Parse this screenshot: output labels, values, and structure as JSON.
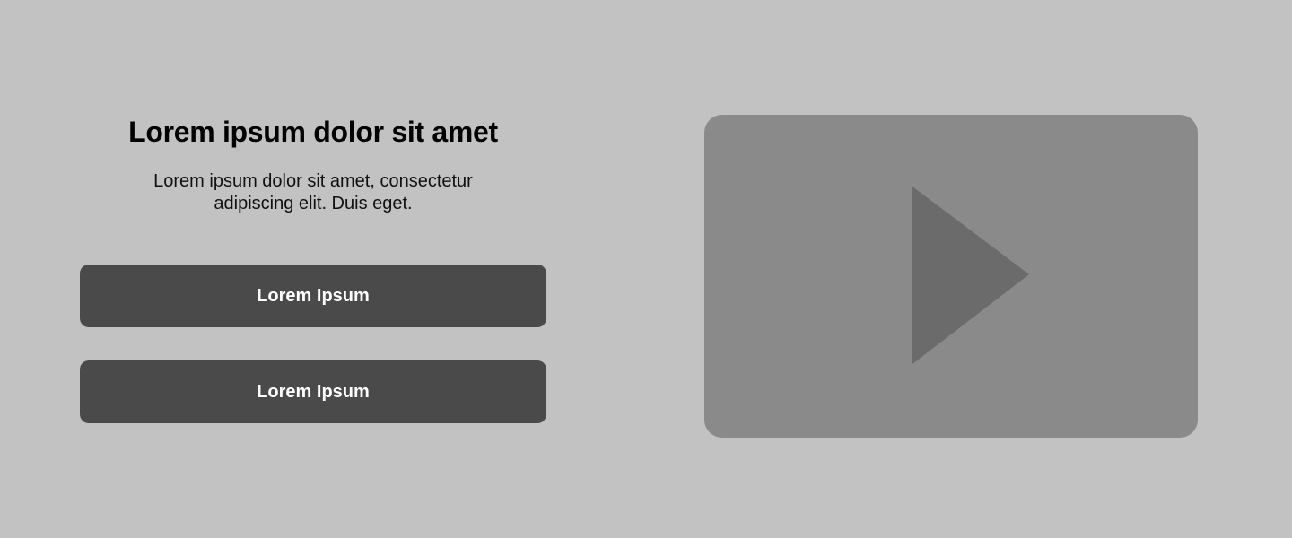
{
  "hero": {
    "title": "Lorem ipsum dolor sit amet",
    "subtitle": "Lorem ipsum dolor sit amet, consectetur adipiscing elit. Duis eget."
  },
  "buttons": [
    {
      "label": "Lorem Ipsum"
    },
    {
      "label": "Lorem Ipsum"
    }
  ],
  "video": {
    "icon": "play-icon"
  },
  "colors": {
    "background": "#c2c2c2",
    "button": "#4a4a4a",
    "button_text": "#ffffff",
    "video_placeholder": "#8a8a8a",
    "play_icon": "#6b6b6b"
  }
}
